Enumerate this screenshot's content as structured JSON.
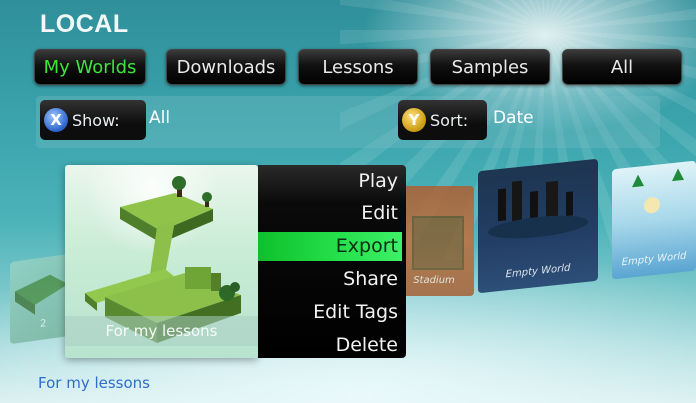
{
  "header": {
    "title": "LOCAL"
  },
  "tabs": [
    {
      "label": "My Worlds",
      "active": true
    },
    {
      "label": "Downloads",
      "active": false
    },
    {
      "label": "Lessons",
      "active": false
    },
    {
      "label": "Samples",
      "active": false
    },
    {
      "label": "All",
      "active": false
    }
  ],
  "filters": {
    "show": {
      "button": "X",
      "label": "Show:",
      "value": "All"
    },
    "sort": {
      "button": "Y",
      "label": "Sort:",
      "value": "Date"
    }
  },
  "carousel": {
    "tiles": [
      {
        "label": "2"
      },
      {
        "label": "Stadium"
      },
      {
        "label": "Empty World"
      },
      {
        "label": "Empty World"
      }
    ]
  },
  "selected_world": {
    "caption": "For my lessons"
  },
  "context_menu": {
    "items": [
      "Play",
      "Edit",
      "Export",
      "Share",
      "Edit Tags",
      "Delete"
    ],
    "highlighted": "Export"
  },
  "footer": {
    "description": "For my lessons"
  },
  "colors": {
    "active_tab_text": "#3de53a",
    "menu_highlight": "#24e04b",
    "x_button": "#2a62c9",
    "y_button": "#c99a10",
    "footer_text": "#2e6ec9"
  }
}
